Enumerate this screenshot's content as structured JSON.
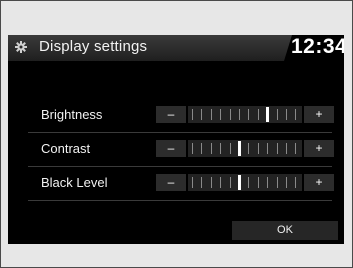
{
  "header": {
    "title": "Display settings",
    "clock": "12:34",
    "icon": "gear-icon"
  },
  "settings": [
    {
      "label": "Brightness",
      "level": 9,
      "steps": 12,
      "minus": "–",
      "plus": "+"
    },
    {
      "label": "Contrast",
      "level": 6,
      "steps": 12,
      "minus": "–",
      "plus": "+"
    },
    {
      "label": "Black Level",
      "level": 6,
      "steps": 12,
      "minus": "–",
      "plus": "+"
    }
  ],
  "footer": {
    "ok_label": "OK"
  }
}
